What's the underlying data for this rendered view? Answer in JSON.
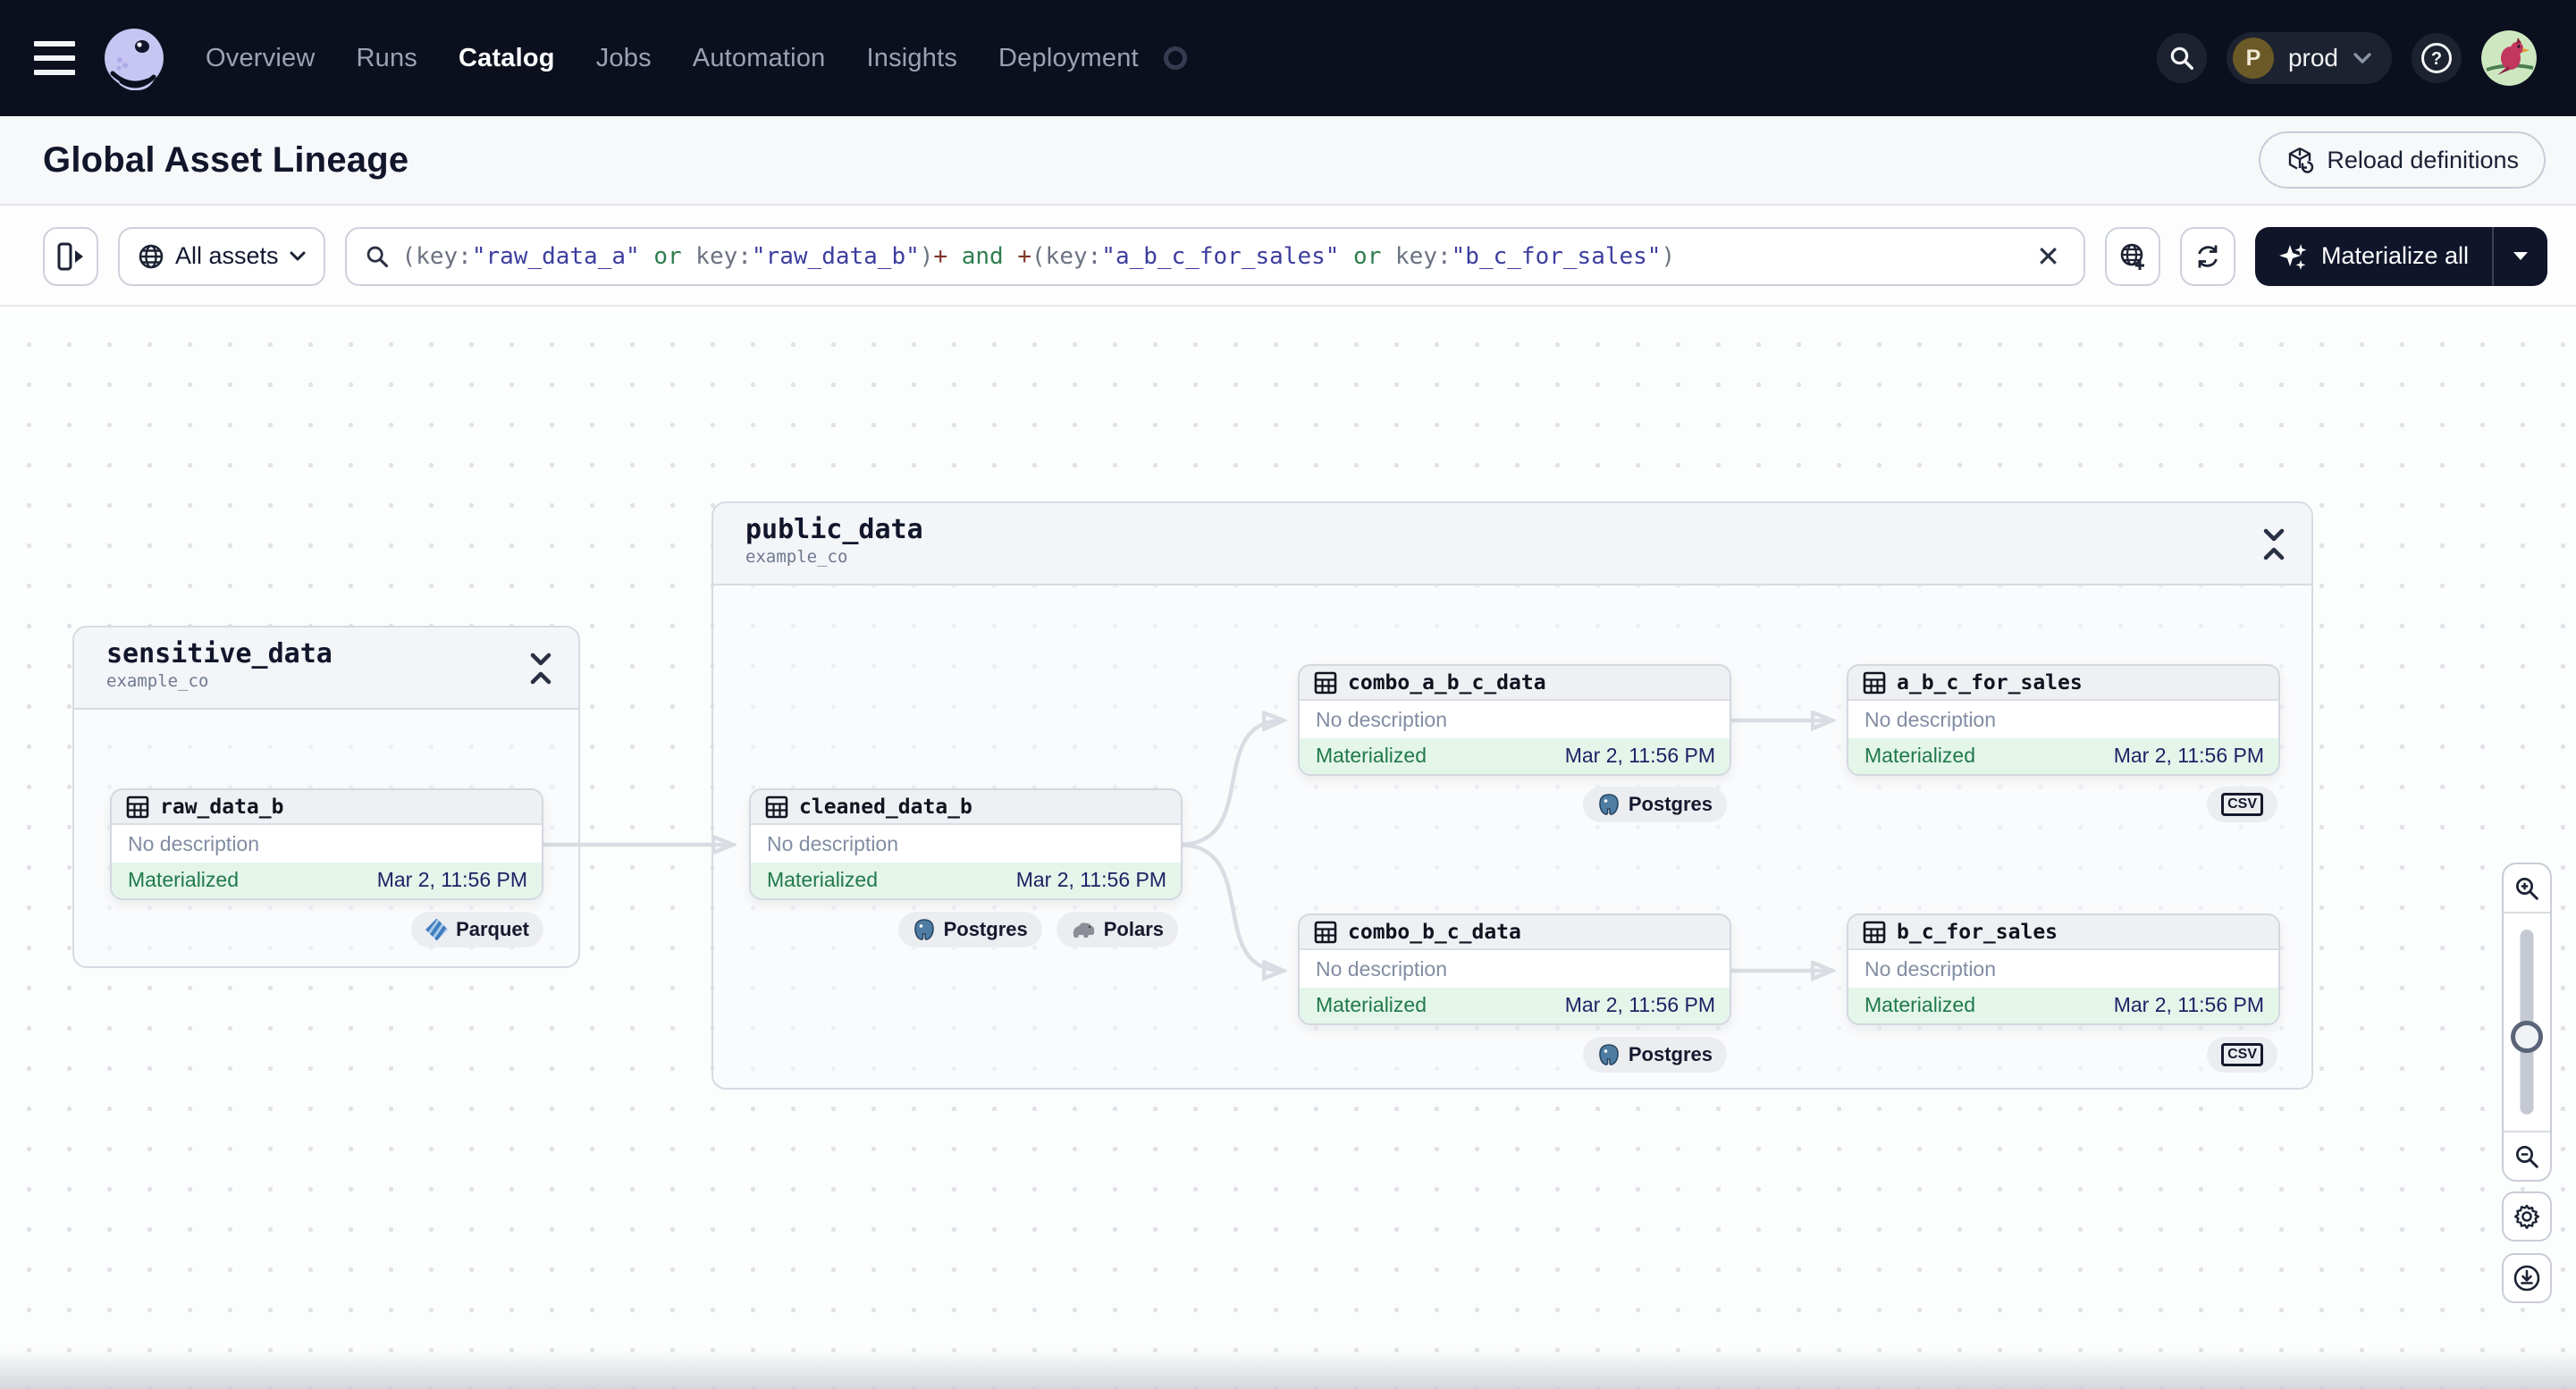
{
  "nav": {
    "items": [
      "Overview",
      "Runs",
      "Catalog",
      "Jobs",
      "Automation",
      "Insights",
      "Deployment"
    ],
    "active_item": "Catalog",
    "workspace": {
      "initial": "P",
      "label": "prod"
    }
  },
  "page": {
    "title": "Global Asset Lineage",
    "reload_button": "Reload definitions"
  },
  "toolbar": {
    "scope_button": "All assets",
    "materialize_button": "Materialize all",
    "clear_label": "✕",
    "query": [
      {
        "t": "(key:"
      },
      {
        "t": "\"raw_data_a\""
      },
      {
        "t": " or "
      },
      {
        "t": "key:"
      },
      {
        "t": "\"raw_data_b\""
      },
      {
        "t": ")"
      },
      {
        "t": "+"
      },
      {
        "t": " and "
      },
      {
        "t": "+"
      },
      {
        "t": "(key:"
      },
      {
        "t": "\"a_b_c_for_sales\""
      },
      {
        "t": " or "
      },
      {
        "t": "key:"
      },
      {
        "t": "\"b_c_for_sales\""
      },
      {
        "t": ")"
      }
    ]
  },
  "graph": {
    "groups": [
      {
        "name": "sensitive_data",
        "location": "example_co"
      },
      {
        "name": "public_data",
        "location": "example_co"
      }
    ],
    "nodes": [
      {
        "name": "raw_data_b",
        "description": "No description",
        "status": "Materialized",
        "timestamp": "Mar 2, 11:56 PM",
        "badges": [
          {
            "label": "Parquet",
            "kind": "parquet"
          }
        ]
      },
      {
        "name": "cleaned_data_b",
        "description": "No description",
        "status": "Materialized",
        "timestamp": "Mar 2, 11:56 PM",
        "badges": [
          {
            "label": "Postgres",
            "kind": "postgres"
          },
          {
            "label": "Polars",
            "kind": "polars"
          }
        ]
      },
      {
        "name": "combo_a_b_c_data",
        "description": "No description",
        "status": "Materialized",
        "timestamp": "Mar 2, 11:56 PM",
        "badges": [
          {
            "label": "Postgres",
            "kind": "postgres"
          }
        ]
      },
      {
        "name": "a_b_c_for_sales",
        "description": "No description",
        "status": "Materialized",
        "timestamp": "Mar 2, 11:56 PM",
        "badges": [
          {
            "label": "CSV",
            "kind": "csv"
          }
        ]
      },
      {
        "name": "combo_b_c_data",
        "description": "No description",
        "status": "Materialized",
        "timestamp": "Mar 2, 11:56 PM",
        "badges": [
          {
            "label": "Postgres",
            "kind": "postgres"
          }
        ]
      },
      {
        "name": "b_c_for_sales",
        "description": "No description",
        "status": "Materialized",
        "timestamp": "Mar 2, 11:56 PM",
        "badges": [
          {
            "label": "CSV",
            "kind": "csv"
          }
        ]
      }
    ]
  }
}
